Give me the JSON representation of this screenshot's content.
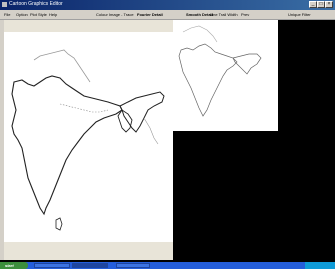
{
  "window": {
    "title": "Cartoon Graphics Editor",
    "min_label": "_",
    "max_label": "□",
    "close_label": "×"
  },
  "menu": {
    "items": [
      "File",
      "Option",
      "Plot Style",
      "Help"
    ],
    "center_items": [
      "Colour Image - Trace",
      "Fourier Detail"
    ],
    "right_items": [
      "Smooth Detail",
      "Line Trail Width",
      "Prev",
      "Unique Filter"
    ]
  },
  "taskbar": {
    "start_label": "start",
    "tray_label": ""
  },
  "colors": {
    "title_gradient_start": "#0a246a",
    "menu_bg": "#d4d0c8",
    "panel_bg": "#e8e4d8",
    "taskbar": "#245edb",
    "black_bg": "#000000"
  }
}
